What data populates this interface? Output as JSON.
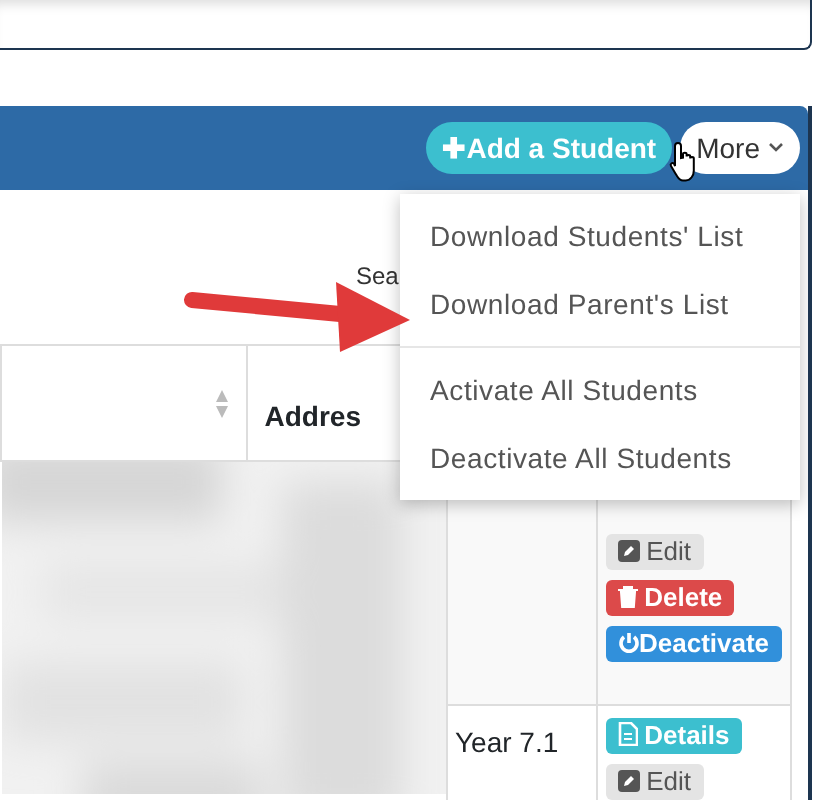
{
  "header": {
    "buttons": [
      {
        "kind": "add",
        "label": "✚Add a Student"
      },
      {
        "kind": "more",
        "label": "More"
      }
    ]
  },
  "cursor": {
    "kind": "hand"
  },
  "more_menu": {
    "expanded": true,
    "items": [
      {
        "kind": "item",
        "label": "Download Students' List"
      },
      {
        "kind": "item",
        "label": "Download Parent's List"
      },
      {
        "kind": "divider"
      },
      {
        "kind": "item",
        "label": "Activate All Students"
      },
      {
        "kind": "item",
        "label": "Deactivate All Students"
      }
    ]
  },
  "annotation": {
    "kind": "arrow"
  },
  "search": {
    "label": "Sea"
  },
  "table": {
    "columns": [
      {
        "sortable": true
      },
      {
        "label": "Addres"
      }
    ],
    "rows": [
      {
        "actions": [
          {
            "kind": "edit",
            "label": "Edit"
          },
          {
            "kind": "delete",
            "label": "Delete"
          },
          {
            "kind": "deactivate",
            "label": "Deactivate"
          }
        ]
      },
      {
        "year": "Year 7.1",
        "actions": [
          {
            "kind": "details",
            "label": "Details"
          },
          {
            "kind": "edit",
            "label": "Edit"
          }
        ]
      }
    ]
  }
}
